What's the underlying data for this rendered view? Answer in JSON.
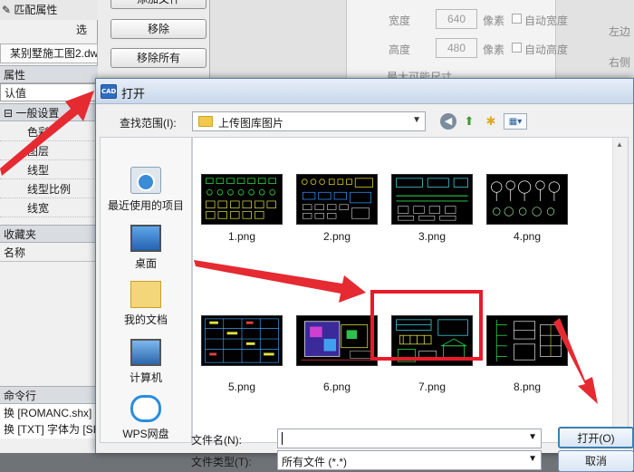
{
  "background_app": {
    "top_label": "匹配属性",
    "top_label_right": "选",
    "tab": "某别墅施工图2.dw",
    "section_properties": "属性",
    "default_value": "认值",
    "general_settings": "一般设置",
    "props": [
      "色彩",
      "图层",
      "线型",
      "线型比例",
      "线宽"
    ],
    "favorites": "收藏夹",
    "name": "名称",
    "command_line": "命令行",
    "cmd_lines": [
      "换 [ROMANC.shx]",
      "换 [TXT] 字体为 [SI"
    ],
    "buttons": [
      "添加文件",
      "移除",
      "移除所有"
    ],
    "width_label": "宽度",
    "width_value": "640",
    "height_label": "高度",
    "height_value": "480",
    "pixel_unit": "像素",
    "auto_width": "自动宽度",
    "auto_height": "自动高度",
    "max_size": "最大可能尺寸",
    "right_labels": [
      "左边",
      "右侧"
    ]
  },
  "dialog": {
    "title": "打开",
    "app_icon_text": "CAD",
    "lookin_label": "查找范围(I):",
    "lookin_value": "上传图库图片",
    "places": [
      "最近使用的项目",
      "桌面",
      "我的文档",
      "计算机",
      "WPS网盘"
    ],
    "files": [
      "1.png",
      "2.png",
      "3.png",
      "4.png",
      "5.png",
      "6.png",
      "7.png",
      "8.png"
    ],
    "filename_label": "文件名(N):",
    "filename_value": "",
    "filetype_label": "文件类型(T):",
    "filetype_value": "所有文件 (*.*)",
    "open_button": "打开(O)",
    "cancel_button": "取消"
  },
  "colors": {
    "highlight": "#e81b2b",
    "arrow": "#e52a32"
  }
}
